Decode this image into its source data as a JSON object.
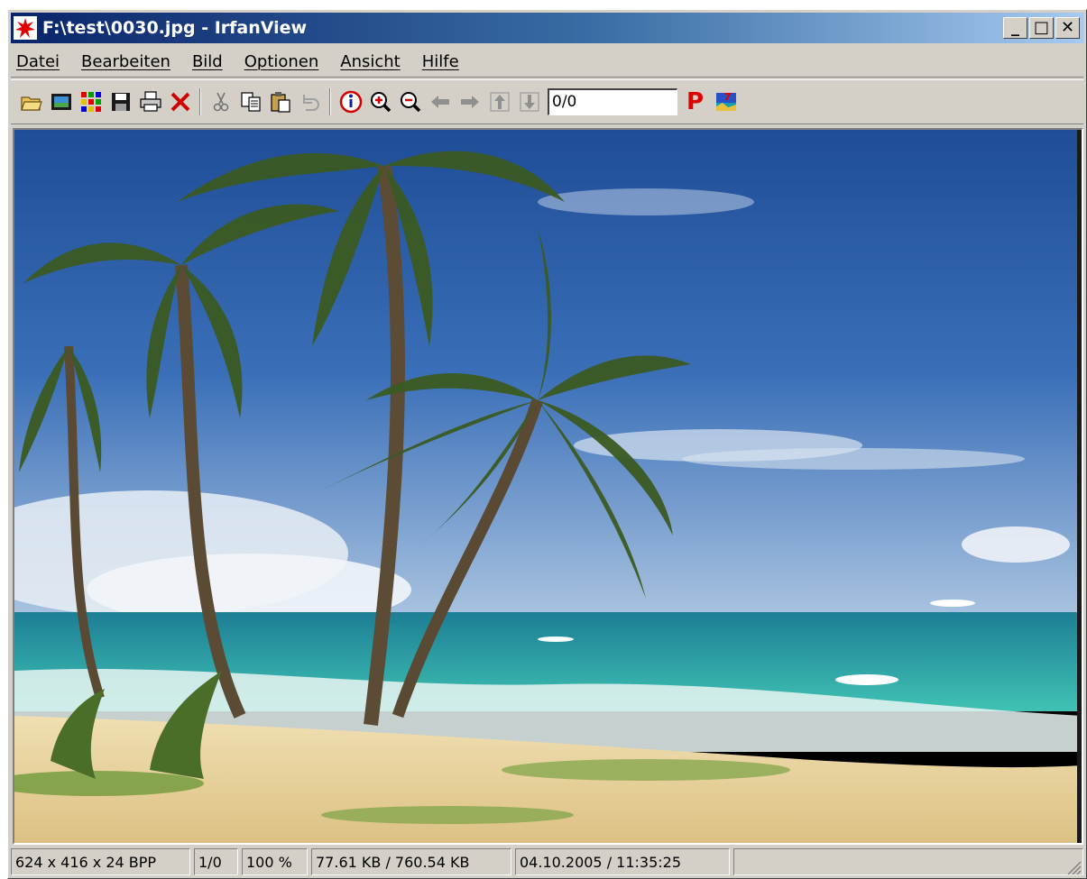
{
  "window": {
    "title": "F:\\test\\0030.jpg - IrfanView",
    "minimize_label": "_",
    "maximize_label": "□",
    "close_label": "✕"
  },
  "menu": {
    "items": [
      {
        "label": "Datei"
      },
      {
        "label": "Bearbeiten"
      },
      {
        "label": "Bild"
      },
      {
        "label": "Optionen"
      },
      {
        "label": "Ansicht"
      },
      {
        "label": "Hilfe"
      }
    ]
  },
  "toolbar": {
    "icons": [
      "open-folder-icon",
      "slideshow-icon",
      "thumbnails-icon",
      "save-icon",
      "print-icon",
      "delete-icon",
      "cut-icon",
      "copy-icon",
      "paste-icon",
      "undo-icon",
      "info-icon",
      "zoom-in-icon",
      "zoom-out-icon",
      "previous-icon",
      "next-icon",
      "first-icon",
      "last-icon",
      "palette-p-icon",
      "landscape-icon"
    ],
    "page_indicator": "0/0",
    "p_label": "P"
  },
  "image": {
    "description_icon": "beach-palm-photo",
    "colors": {
      "sky": "#2f5fa8",
      "sea": "#2aa6a4",
      "sand": "#e9d6a0",
      "palm": "#3e5a1e"
    }
  },
  "status": {
    "dimensions": "624 x 416 x 24 BPP",
    "index": "1/0",
    "zoom": "100 %",
    "filesize": "77.61 KB / 760.54 KB",
    "datetime": "04.10.2005 / 11:35:25",
    "extra": ""
  }
}
